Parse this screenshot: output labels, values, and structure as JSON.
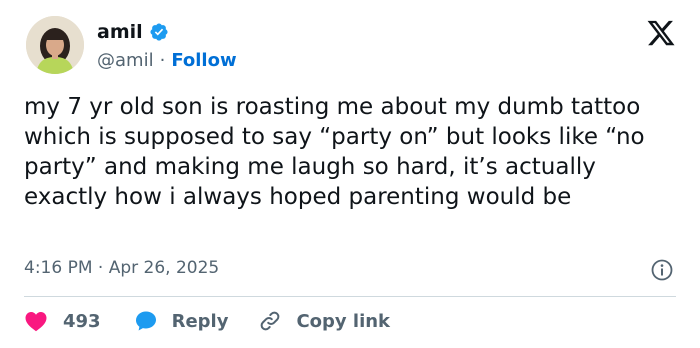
{
  "author": {
    "name": "amil",
    "handle": "@amil",
    "separator": "·",
    "follow_label": "Follow"
  },
  "tweet": {
    "text": "my 7 yr old son is roasting me about my dumb tattoo which is supposed to say “party on” but looks like “no party” and making me laugh so hard, it’s actually exactly how i always hoped parenting would be",
    "timestamp": "4:16 PM · Apr 26, 2025"
  },
  "actions": {
    "like_count": "493",
    "reply_label": "Reply",
    "copy_link_label": "Copy link"
  },
  "icons": {
    "verified": "verified-badge-icon",
    "logo": "x-logo-icon",
    "info": "info-icon",
    "like": "heart-icon",
    "reply": "reply-bubble-icon",
    "copy": "link-icon"
  },
  "colors": {
    "text": "#0f1419",
    "muted": "#536471",
    "accent": "#006fd6",
    "verified": "#1d9bf0",
    "like": "#f91880",
    "divider": "#cfd9de"
  }
}
